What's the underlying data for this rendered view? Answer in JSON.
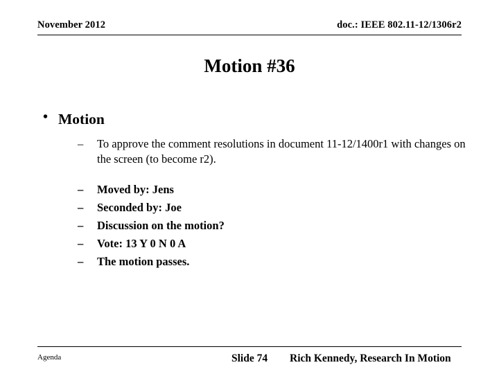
{
  "header": {
    "date": "November 2012",
    "doc": "doc.: IEEE 802.11-12/1306r2"
  },
  "title": "Motion #36",
  "content": {
    "level1": {
      "bullet_glyph": "•",
      "text": "Motion"
    },
    "dash_glyph": "–",
    "items": [
      {
        "text": "To approve the comment resolutions in document 11-12/1400r1 with changes on the screen (to become r2).",
        "bold": false
      },
      {
        "text": "Moved by: Jens",
        "bold": true
      },
      {
        "text": "Seconded by: Joe",
        "bold": true
      },
      {
        "text": "Discussion on the motion?",
        "bold": true
      },
      {
        "text": "Vote:    13  Y   0  N  0 A",
        "bold": true
      },
      {
        "text": "The motion passes.",
        "bold": true
      }
    ]
  },
  "footer": {
    "agenda": "Agenda",
    "slide": "Slide 74",
    "author": "Rich Kennedy, Research In Motion"
  }
}
